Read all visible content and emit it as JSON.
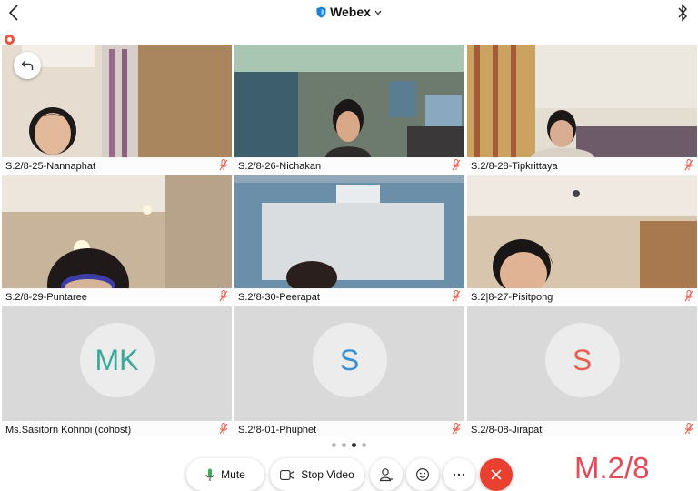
{
  "app": {
    "title": "Webex"
  },
  "participants": [
    {
      "name": "S.2/8-25-Nannaphat",
      "type": "video"
    },
    {
      "name": "S.2/8-26-Nichakan",
      "type": "video"
    },
    {
      "name": "S.2/8-28-Tipkrittaya",
      "type": "video"
    },
    {
      "name": "S.2/8-29-Puntaree",
      "type": "video"
    },
    {
      "name": "S.2/8-30-Peerapat",
      "type": "video"
    },
    {
      "name": "S.2|8-27-Pisitpong",
      "type": "video"
    },
    {
      "name": "Ms.Sasitorn Kohnoi (cohost)",
      "type": "avatar",
      "initials": "MK",
      "color": "#3aa89a"
    },
    {
      "name": "S.2/8-01-Phuphet",
      "type": "avatar",
      "initials": "S",
      "color": "#3a8fd1"
    },
    {
      "name": "S.2/8-08-Jirapat",
      "type": "avatar",
      "initials": "S",
      "color": "#e8604f"
    }
  ],
  "pager": {
    "pages": 4,
    "active": 3
  },
  "controls": {
    "mute_label": "Mute",
    "stop_video_label": "Stop Video"
  },
  "overlay": {
    "class_label": "M.2/8"
  },
  "colors": {
    "accent": "#1d7fd1",
    "end_call": "#e9402f",
    "mic_muted": "#e8604f"
  }
}
